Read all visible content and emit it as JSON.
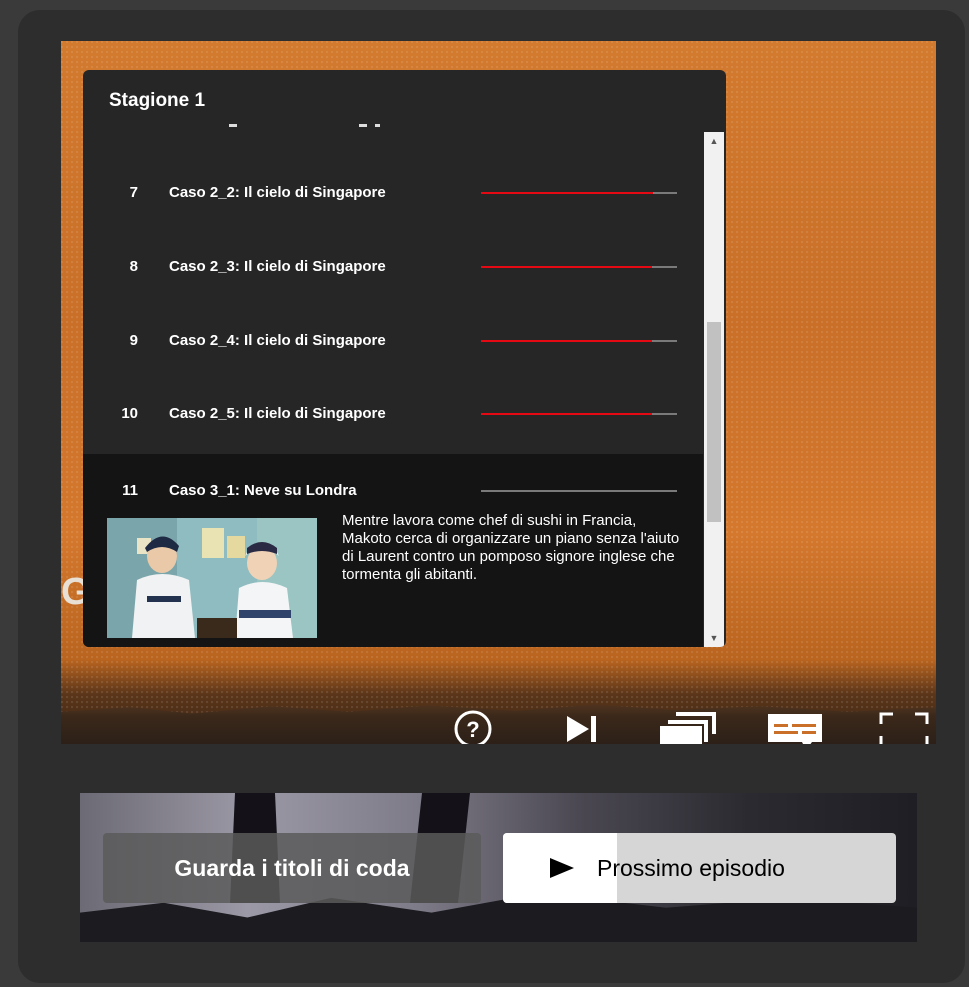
{
  "panel": {
    "season_title": "Stagione 1",
    "episodes": [
      {
        "number": "7",
        "title": "Caso 2_2: Il cielo di Singapore",
        "progress": 0.88
      },
      {
        "number": "8",
        "title": "Caso 2_3: Il cielo di Singapore",
        "progress": 0.87
      },
      {
        "number": "9",
        "title": "Caso 2_4: Il cielo di Singapore",
        "progress": 0.87
      },
      {
        "number": "10",
        "title": "Caso 2_5: Il cielo di Singapore",
        "progress": 0.87
      }
    ],
    "active_episode": {
      "number": "11",
      "title": "Caso 3_1: Neve su Londra",
      "progress": 0,
      "description": "Mentre lavora come chef di sushi in Francia, Makoto cerca di organizzare un piano senza l'aiuto di Laurent contro un pomposo signore inglese che tormenta gli abitanti."
    }
  },
  "controls": {
    "icons": [
      "help-icon",
      "next-episode-icon",
      "episodes-icon",
      "subtitles-icon",
      "fullscreen-icon"
    ]
  },
  "actions": {
    "credits_label": "Guarda i titoli di coda",
    "next_label": "Prossimo episodio",
    "next_progress": 0.29
  },
  "colors": {
    "accent_red": "#e50914",
    "panel_bg": "#262626",
    "active_row_bg": "#141414"
  }
}
